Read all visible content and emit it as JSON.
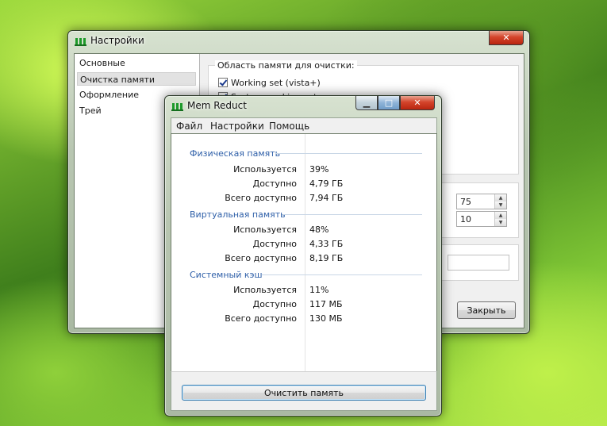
{
  "settings_window": {
    "title": "Настройки",
    "nav": [
      "Основные",
      "Очистка памяти",
      "Оформление",
      "Трей"
    ],
    "selected_nav": "Очистка памяти",
    "group_title": "Область памяти для очистки:",
    "checkboxes": [
      {
        "label": "Working set (vista+)",
        "checked": true
      },
      {
        "label": "System working set",
        "checked": true
      }
    ],
    "spin1_value": "75",
    "spin2_value": "10",
    "close_button": "Закрыть",
    "close_glyph": "✕"
  },
  "memreduct_window": {
    "title": "Mem Reduct",
    "menu": [
      "Файл",
      "Настройки",
      "Помощь"
    ],
    "sections": [
      {
        "title": "Физическая память",
        "rows": [
          {
            "label": "Используется",
            "value": "39%"
          },
          {
            "label": "Доступно",
            "value": "4,79 ГБ"
          },
          {
            "label": "Всего доступно",
            "value": "7,94 ГБ"
          }
        ]
      },
      {
        "title": "Виртуальная память",
        "rows": [
          {
            "label": "Используется",
            "value": "48%"
          },
          {
            "label": "Доступно",
            "value": "4,33 ГБ"
          },
          {
            "label": "Всего доступно",
            "value": "8,19 ГБ"
          }
        ]
      },
      {
        "title": "Системный кэш",
        "rows": [
          {
            "label": "Используется",
            "value": "11%"
          },
          {
            "label": "Доступно",
            "value": "117 МБ"
          },
          {
            "label": "Всего доступно",
            "value": "130 МБ"
          }
        ]
      }
    ],
    "clean_button": "Очистить память",
    "min_glyph": "▁",
    "max_glyph": "□",
    "close_glyph": "✕"
  },
  "colors": {
    "section_title": "#2e5fa8",
    "close_button_red": "#d4452c",
    "app_icon_green": "#1d9a2a"
  },
  "icons": {
    "app": "memory-chip-icon",
    "checkbox": "checkmark-icon",
    "spin": "up-down-arrow-icon"
  }
}
